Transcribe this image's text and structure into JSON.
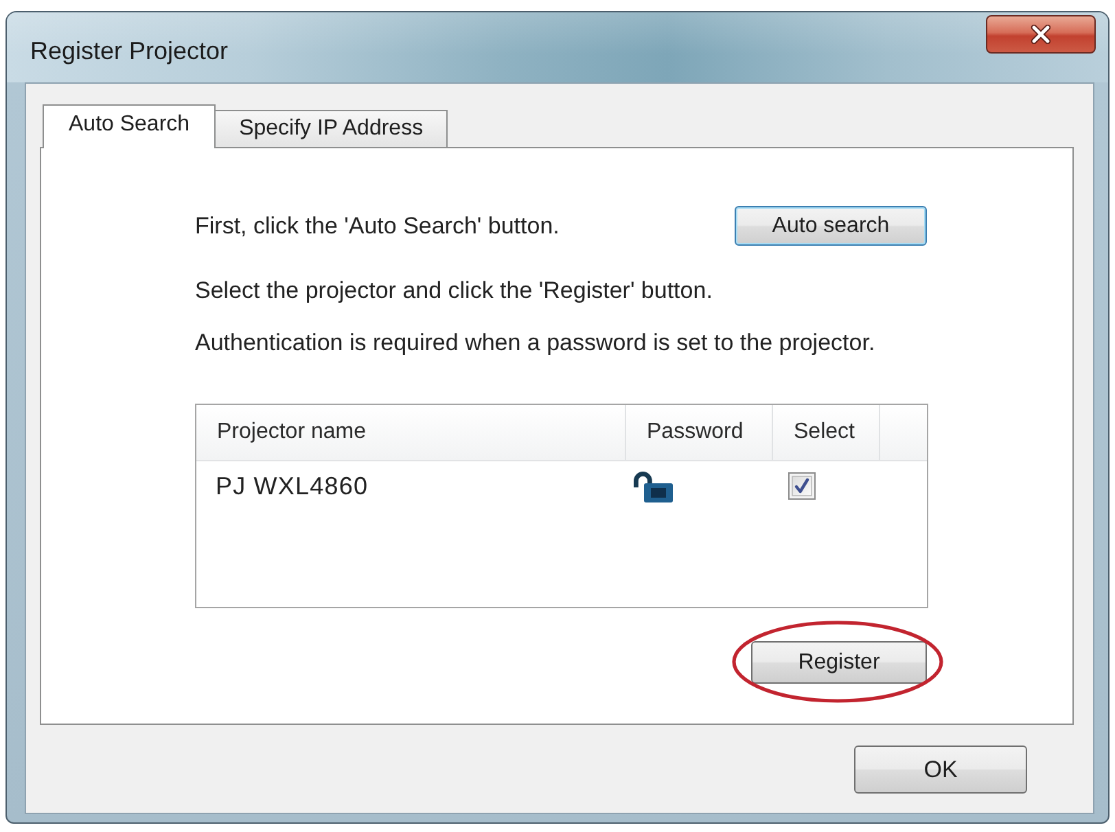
{
  "window": {
    "title": "Register Projector"
  },
  "tabs": [
    {
      "label": "Auto Search",
      "selected": true
    },
    {
      "label": "Specify IP Address",
      "selected": false
    }
  ],
  "instructions": [
    "First, click the 'Auto Search' button.",
    "Select the projector and click the 'Register' button.",
    "Authentication is required when a password is set to the projector."
  ],
  "auto_search_button": {
    "label": "Auto search",
    "focused": true
  },
  "projector_list": {
    "columns": [
      "Projector name",
      "Password",
      "Select"
    ],
    "rows": [
      {
        "name": "PJ WXL4860",
        "locked": false,
        "checked": true,
        "selected": false
      }
    ]
  },
  "register_button": {
    "label": "Register",
    "circled": true
  },
  "ok_button": {
    "label": "OK"
  }
}
